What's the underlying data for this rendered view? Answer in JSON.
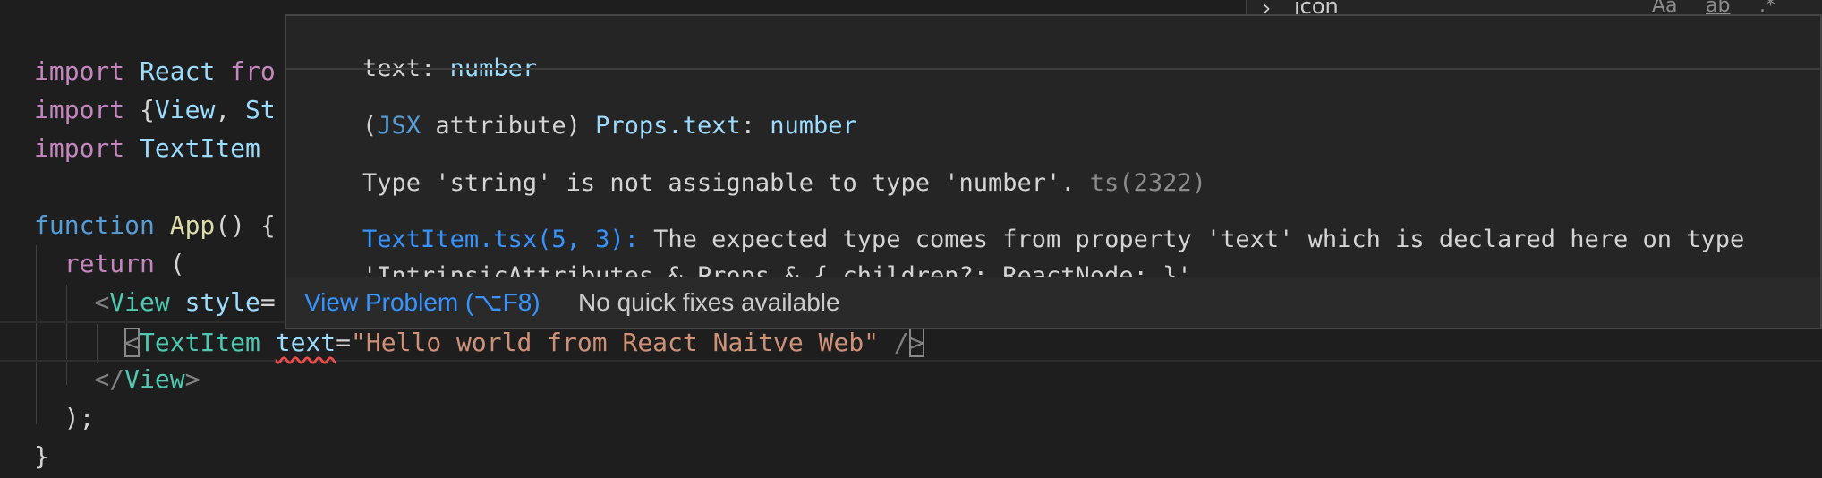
{
  "editor": {
    "lines": [
      {
        "tokens": [
          {
            "t": "import",
            "c": "kw-purple"
          },
          {
            "t": " React ",
            "c": "ident"
          },
          {
            "t": "fro",
            "c": "kw-purple"
          }
        ]
      },
      {
        "tokens": [
          {
            "t": "import",
            "c": "kw-purple"
          },
          {
            "t": " {",
            "c": "punc"
          },
          {
            "t": "View",
            "c": "ident"
          },
          {
            "t": ", ",
            "c": "punc"
          },
          {
            "t": "St",
            "c": "ident"
          }
        ]
      },
      {
        "tokens": [
          {
            "t": "import",
            "c": "kw-purple"
          },
          {
            "t": " TextItem ",
            "c": "ident"
          }
        ]
      },
      {
        "tokens": []
      },
      {
        "tokens": [
          {
            "t": "function",
            "c": "kw-blue"
          },
          {
            "t": " ",
            "c": "punc"
          },
          {
            "t": "App",
            "c": "fn"
          },
          {
            "t": "() {",
            "c": "punc"
          }
        ]
      },
      {
        "tokens": [
          {
            "t": "  ",
            "c": "punc"
          },
          {
            "t": "return",
            "c": "kw-purple"
          },
          {
            "t": " (",
            "c": "punc"
          }
        ]
      },
      {
        "tokens": [
          {
            "t": "    ",
            "c": "punc"
          },
          {
            "t": "<",
            "c": "tag-bracket"
          },
          {
            "t": "View",
            "c": "tag-name"
          },
          {
            "t": " ",
            "c": "punc"
          },
          {
            "t": "style",
            "c": "attr"
          },
          {
            "t": "=",
            "c": "punc"
          }
        ]
      },
      {
        "tokens": [
          {
            "t": "      ",
            "c": "punc"
          },
          {
            "t": "<",
            "c": "tag-bracket"
          },
          {
            "t": "TextItem",
            "c": "tag-name"
          },
          {
            "t": " ",
            "c": "punc"
          },
          {
            "t": "text",
            "c": "attr"
          },
          {
            "t": "=",
            "c": "punc"
          },
          {
            "t": "\"Hello world from React Naitve Web\"",
            "c": "str"
          },
          {
            "t": " /",
            "c": "tag-bracket"
          },
          {
            "t": ">",
            "c": "tag-bracket"
          }
        ]
      },
      {
        "tokens": [
          {
            "t": "    ",
            "c": "punc"
          },
          {
            "t": "</",
            "c": "tag-bracket"
          },
          {
            "t": "View",
            "c": "tag-name"
          },
          {
            "t": ">",
            "c": "tag-bracket"
          }
        ]
      },
      {
        "tokens": [
          {
            "t": "  );",
            "c": "punc"
          }
        ]
      },
      {
        "tokens": [
          {
            "t": "}",
            "c": "punc"
          }
        ]
      }
    ]
  },
  "find_widget": {
    "query": "jcon",
    "chevron": "›",
    "options": [
      "Aa",
      "ab",
      ".*"
    ]
  },
  "hover": {
    "signature": {
      "name": "text",
      "colon": ": ",
      "type": "number"
    },
    "detail": {
      "open_paren": "(",
      "kind": "JSX",
      "kind_rest": " attribute",
      "close_paren": ") ",
      "member": "Props.text",
      "colon": ": ",
      "type": "number"
    },
    "error_message": "Type 'string' is not assignable to type 'number'.",
    "error_code": " ts(2322)",
    "related_location": "TextItem.tsx(5, 3):",
    "related_message_line1": " The expected type comes from property 'text' which is declared here on type",
    "related_message_line2": "'IntrinsicAttributes & Props & { children?: ReactNode; }'",
    "actions": {
      "view_problem": "View Problem (⌥F8)",
      "no_quick_fixes": "No quick fixes available"
    }
  }
}
